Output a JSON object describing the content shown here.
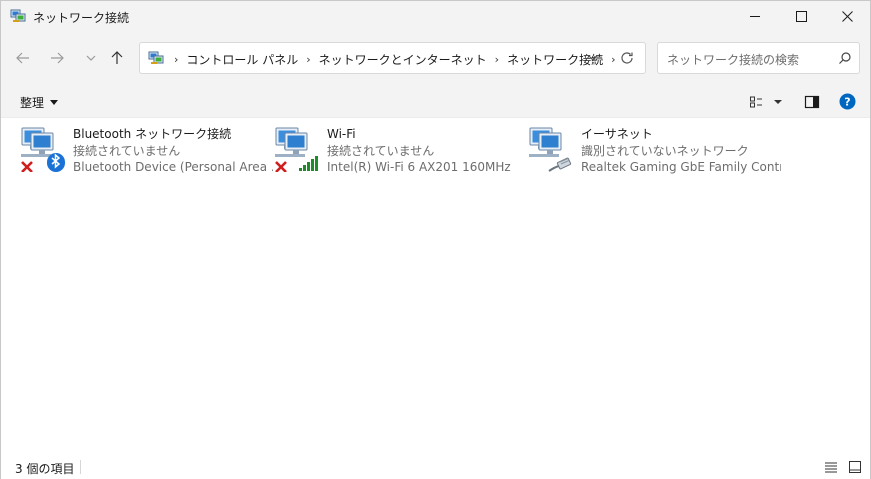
{
  "window": {
    "title": "ネットワーク接続",
    "icons": {
      "app": "network-connections-icon",
      "minimize": "minimize-icon",
      "maximize": "maximize-icon",
      "close": "close-icon"
    }
  },
  "nav": {
    "icons": {
      "back": "arrow-left-icon",
      "forward": "arrow-right-icon",
      "recent": "chevron-down-icon",
      "up": "arrow-up-icon",
      "refresh": "refresh-icon"
    },
    "breadcrumb": [
      "コントロール パネル",
      "ネットワークとインターネット",
      "ネットワーク接続"
    ],
    "search_placeholder": "ネットワーク接続の検索"
  },
  "commandbar": {
    "organize_label": "整理",
    "icons": {
      "view": "view-options-icon",
      "preview_pane": "preview-pane-icon",
      "help": "help-icon"
    }
  },
  "items": [
    {
      "name": "Bluetooth ネットワーク接続",
      "status": "接続されていません",
      "device": "Bluetooth Device (Personal Area ...",
      "badge": "bluetooth-icon",
      "disconnected": true
    },
    {
      "name": "Wi-Fi",
      "status": "接続されていません",
      "device": "Intel(R) Wi-Fi 6 AX201 160MHz",
      "badge": "wifi-signal-icon",
      "disconnected": true
    },
    {
      "name": "イーサネット",
      "status": "識別されていないネットワーク",
      "device": "Realtek Gaming GbE Family Contr...",
      "badge": "ethernet-cable-icon",
      "disconnected": false
    }
  ],
  "statusbar": {
    "count": "3 個の項目",
    "icons": {
      "details": "details-view-icon",
      "tiles": "large-icons-view-icon"
    }
  },
  "colors": {
    "accent": "#0067c0",
    "error": "#d01e1e",
    "signal": "#1f8b2b"
  }
}
